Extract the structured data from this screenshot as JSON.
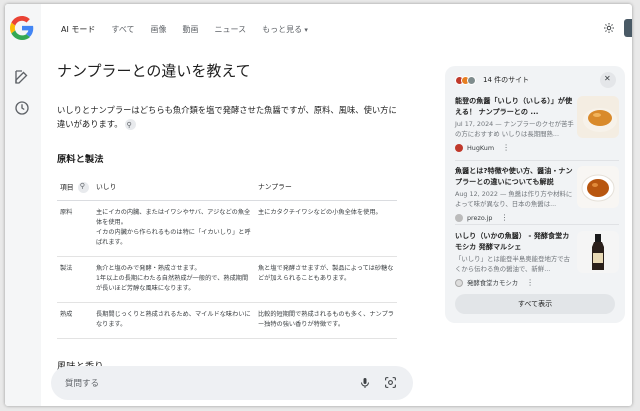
{
  "nav": {
    "items": [
      "AI モード",
      "すべて",
      "画像",
      "動画",
      "ニュース",
      "もっと見る"
    ]
  },
  "main": {
    "heading": "ナンプラーとの違いを教えて",
    "intro": "いしりとナンプラーはどちらも魚介類を塩で発酵させた魚醤ですが、原料、風味、使い方に違いがあります。",
    "section1": "原料と製法",
    "table": {
      "headers": [
        "項目",
        "いしり",
        "ナンプラー"
      ],
      "rows": [
        {
          "label": "原料",
          "ishiri": "主にイカの内臓、またはイワシやサバ、アジなどの魚全体を使用。\nイカの内臓から作られるものは特に「イカいしり」と呼ばれます。",
          "nampla": "主にカタクチイワシなどの小魚全体を使用。"
        },
        {
          "label": "製法",
          "ishiri": "魚介と塩のみで発酵・熟成させます。\n1年以上の長期にわたる自然熟成が一般的で、熟成期間が長いほど芳醇な風味になります。",
          "nampla": "魚と塩で発酵させますが、製品によっては砂糖などが加えられることもあります。"
        },
        {
          "label": "熟成",
          "ishiri": "長期間じっくりと熟成されるため、マイルドな味わいになります。",
          "nampla": "比較的短期間で熟成されるものも多く、ナンプラー独特の強い香りが特徴です。"
        }
      ]
    },
    "section2": "風味と香り"
  },
  "askbar": {
    "placeholder": "質問する"
  },
  "panel": {
    "count_label": "14 件のサイト",
    "cards": [
      {
        "title": "能登の魚醤「いしり（いしる）」が使える！ ナンプラーとの ...",
        "snippet": "Jul 17, 2024 — ナンプラーのクセが苦手の方におすすめ いしりは長期間熟...",
        "source": "HugKum"
      },
      {
        "title": "魚醤とは?特徴や使い方、醤油・ナンプラーとの違いについても解説",
        "snippet": "Aug 12, 2022 — 魚醤は作り方や材料によって味が異なり、日本の魚醤は...",
        "source": "prezo.jp"
      },
      {
        "title": "いしり（いかの魚醤） - 発酵食堂カモシカ 発酵マルシェ",
        "snippet": "「いしり」とは能登半島奥能登地方で古くから伝わる魚の醤油で、新鮮...",
        "source": "発酵食堂カモシカ"
      }
    ],
    "show_all": "すべて表示"
  },
  "colors": {
    "g_blue": "#4285f4",
    "g_red": "#ea4335",
    "g_yellow": "#fbbc05",
    "g_green": "#34a853"
  }
}
